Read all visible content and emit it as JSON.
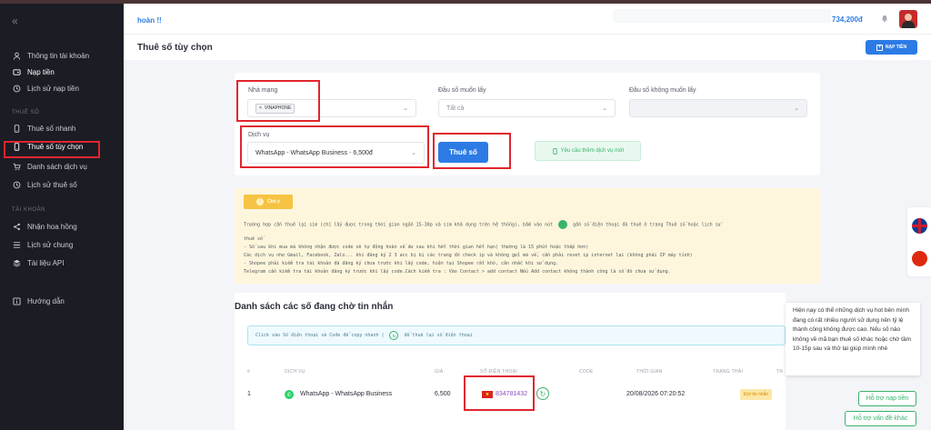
{
  "header": {
    "brand": "hoàn !!",
    "balance": "734,200đ"
  },
  "sidebar": {
    "toggle": "«",
    "items_top": [
      {
        "label": "Thông tin tài khoản",
        "icon": "user-icon"
      },
      {
        "label": "Nạp tiền",
        "icon": "wallet-icon"
      },
      {
        "label": "Lịch sử nạp tiền",
        "icon": "history-icon"
      }
    ],
    "section_thue": "THUÊ SỐ",
    "items_thue": [
      {
        "label": "Thuê số nhanh",
        "icon": "phone-icon"
      },
      {
        "label": "Thuê số tùy chọn",
        "icon": "phone-settings-icon"
      },
      {
        "label": "Danh sách dịch vụ",
        "icon": "cart-icon"
      },
      {
        "label": "Lịch sử thuê số",
        "icon": "history-icon"
      }
    ],
    "section_taikhoan": "TÀI KHOẢN",
    "items_taikhoan": [
      {
        "label": "Nhận hoa hồng",
        "icon": "share-icon"
      },
      {
        "label": "Lịch sử chung",
        "icon": "list-icon"
      },
      {
        "label": "Tài liệu API",
        "icon": "layers-icon"
      }
    ],
    "help": {
      "label": "Hướng dẫn",
      "icon": "info-icon"
    }
  },
  "page": {
    "title": "Thuê số tùy chọn",
    "topup_button": "NẠP TIỀN"
  },
  "form": {
    "carrier_label": "Nhà mạng",
    "carrier_tag": "VINAPHONE",
    "prefix_label": "Đầu số muốn lấy",
    "prefix_value": "Tất cả",
    "exclude_label": "Đầu số không muốn lấy",
    "service_label": "Dịch vụ",
    "service_value": "WhatsApp - WhatsApp Business - 6,500đ",
    "rent_button": "Thuê số",
    "request_button": "Yêu cầu thêm dịch vụ mới"
  },
  "notice": {
    "badge": "Chú ý",
    "line1a": "Trường hợp cần thuê lại sim (chỉ lấy được trong thời gian ngắn 15-30p và sim khả dụng trên hệ thống), bấm vào nút",
    "line1b": "gần số điện thoại đã thuê ở trang Thuê số hoặc lịch sử",
    "line2": "thuê số",
    "line3": "- Số sau khi mua mà không nhận được code sẽ tự động hoàn về dư sau khi hết thời gian hết hạn( thường là 15 phút hoặc thấp hơn)",
    "line4": "  Các dịch vụ như Gmail, Facebook, Zalo... khi đăng ký 2 3 acc bị bị các trang đó check ip và không gửi mã về, cần phải reset ip internet lại (không phải IP máy tính)",
    "line5": "- Shopee phải kiểm tra tài khoản đã đăng ký chưa trước khi lấy code, hiện tại Shopee rất khó, cân nhắc khi sử dụng.",
    "line6": "  Telegram cần kiểm tra tài khoản đăng ký trước khi lấy code.Cách kiểm tra : Vào Contact > add contact Nếu Add contact không thành công là số đó chưa sử dụng."
  },
  "list": {
    "title": "Danh sách các số đang chờ tin nhắn",
    "hint_a": "Click vào Số điện thoại và Code để copy nhanh |",
    "hint_b": "để thuê lại số điện thoại",
    "columns": [
      "#",
      "DỊCH VỤ",
      "GIÁ",
      "SỐ ĐIỆN THOẠI",
      "CODE",
      "THỜI GIAN",
      "TRẠNG THÁI",
      "TR"
    ],
    "rows": [
      {
        "index": "1",
        "service": "WhatsApp - WhatsApp Business",
        "price": "6,500",
        "phone": "834781432",
        "time": "20/08/2026 07:20:52",
        "status": "Đợi tin nhắn"
      }
    ]
  },
  "tooltip": "Hiện nay có thể những dịch vụ hot bên mình đang có rất nhiều người sử dụng nên tỷ lệ thành công không được cao. Nếu số nào không về mã bạn thuê số khác hoặc chờ tầm 10-15p sau và thử lại giúp mình nhé",
  "support": {
    "topup": "Hỗ trợ nạp tiền",
    "other": "Hỗ trợ vấn đề khác"
  },
  "colors": {
    "accent": "#2c7be5",
    "sidebar": "#1c1c24",
    "highlight": "#e0262f",
    "success": "#3bb36a"
  }
}
